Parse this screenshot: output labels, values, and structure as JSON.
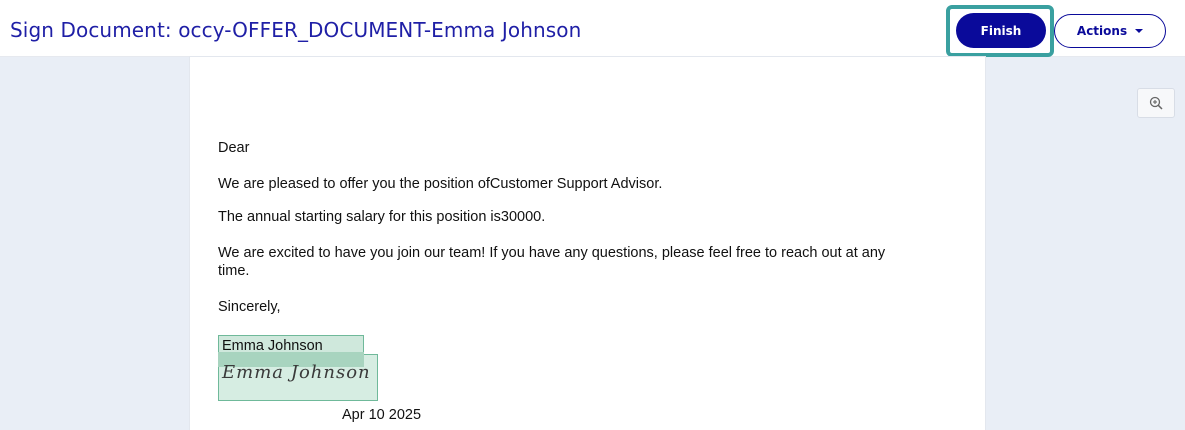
{
  "header": {
    "title": "Sign Document: occy-OFFER_DOCUMENT-Emma Johnson",
    "finish_label": "Finish",
    "actions_label": "Actions"
  },
  "toolbar": {
    "zoom_icon": "zoom-in-icon"
  },
  "document": {
    "salutation": "Dear",
    "line1": "We are pleased to offer you the position ofCustomer Support Advisor.",
    "line2": "The annual starting salary for this position is30000.",
    "line3a": "We are excited to have you join our team! If you have any questions, please feel free to reach out at any",
    "line3b": "time.",
    "closing": "Sincerely,",
    "signer_name": "Emma Johnson",
    "signature_script": "Emma Johnson",
    "date": "Apr 10 2025"
  },
  "colors": {
    "brand": "#0a0a9a",
    "highlight": "#3aa0a0",
    "signature_field": "#cfe8dc"
  }
}
